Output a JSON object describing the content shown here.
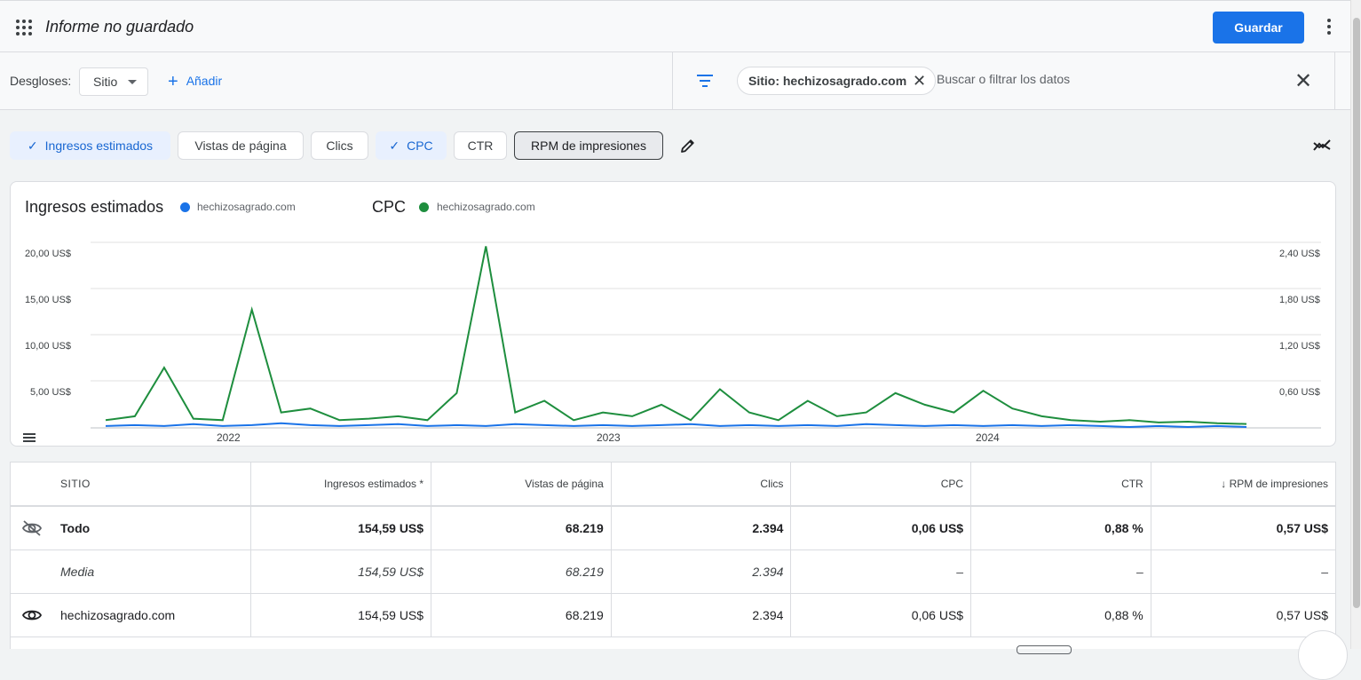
{
  "header": {
    "title": "Informe no guardado",
    "save_label": "Guardar"
  },
  "filters": {
    "breakdowns_label": "Desgloses:",
    "breakdown_value": "Sitio",
    "add_label": "Añadir",
    "active_filter": "Sitio: hechizosagrado.com",
    "search_placeholder": "Buscar o filtrar los datos"
  },
  "metrics": [
    {
      "label": "Ingresos estimados",
      "selected": true
    },
    {
      "label": "Vistas de página",
      "selected": false
    },
    {
      "label": "Clics",
      "selected": false
    },
    {
      "label": "CPC",
      "selected": true
    },
    {
      "label": "CTR",
      "selected": false
    },
    {
      "label": "RPM de impresiones",
      "selected": false
    }
  ],
  "chart": {
    "left_title": "Ingresos estimados",
    "left_legend": "hechizosagrado.com",
    "right_title": "CPC",
    "right_legend": "hechizosagrado.com",
    "left_series_color": "#1a73e8",
    "right_series_color": "#1e8e3e",
    "left_ticks": [
      "20,00 US$",
      "15,00 US$",
      "10,00 US$",
      "5,00 US$"
    ],
    "right_ticks": [
      "2,40 US$",
      "1,80 US$",
      "1,20 US$",
      "0,60 US$"
    ],
    "x_ticks": [
      "2022",
      "2023",
      "2024"
    ]
  },
  "chart_data": {
    "type": "line",
    "x_range": [
      "2021-08",
      "2024-11"
    ],
    "series": [
      {
        "name": "hechizosagrado.com",
        "metric": "Ingresos estimados",
        "axis": "left",
        "values_note_free": true,
        "values": [
          0.2,
          0.3,
          0.2,
          0.4,
          0.2,
          0.3,
          0.5,
          0.3,
          0.2,
          0.3,
          0.4,
          0.2,
          0.3,
          0.2,
          0.4,
          0.3,
          0.2,
          0.3,
          0.2,
          0.3,
          0.4,
          0.2,
          0.3,
          0.2,
          0.3,
          0.2,
          0.4,
          0.3,
          0.2,
          0.3,
          0.2,
          0.3,
          0.2,
          0.3,
          0.2,
          0.1,
          0.2,
          0.1,
          0.2,
          0.1
        ]
      },
      {
        "name": "hechizosagrado.com",
        "metric": "CPC",
        "axis": "right",
        "values": [
          0.1,
          0.15,
          0.78,
          0.12,
          0.1,
          1.53,
          0.2,
          0.25,
          0.1,
          0.12,
          0.15,
          0.1,
          0.45,
          2.35,
          0.2,
          0.35,
          0.1,
          0.2,
          0.15,
          0.3,
          0.1,
          0.5,
          0.2,
          0.1,
          0.35,
          0.15,
          0.2,
          0.45,
          0.3,
          0.2,
          0.48,
          0.25,
          0.15,
          0.1,
          0.08,
          0.1,
          0.07,
          0.08,
          0.06,
          0.05
        ]
      }
    ],
    "ylim_left": [
      0,
      20
    ],
    "ylim_right": [
      0,
      2.4
    ]
  },
  "table": {
    "headers": [
      "SITIO",
      "Ingresos estimados *",
      "Vistas de página",
      "Clics",
      "CPC",
      "CTR",
      "↓ RPM de impresiones"
    ],
    "rows": [
      {
        "name": "Todo",
        "values": [
          "154,59 US$",
          "68.219",
          "2.394",
          "0,06 US$",
          "0,88 %",
          "0,57 US$"
        ]
      },
      {
        "name": "Media",
        "values": [
          "154,59 US$",
          "68.219",
          "2.394",
          "–",
          "–",
          "–"
        ]
      },
      {
        "name": "hechizosagrado.com",
        "values": [
          "154,59 US$",
          "68.219",
          "2.394",
          "0,06 US$",
          "0,88 %",
          "0,57 US$"
        ]
      }
    ]
  }
}
